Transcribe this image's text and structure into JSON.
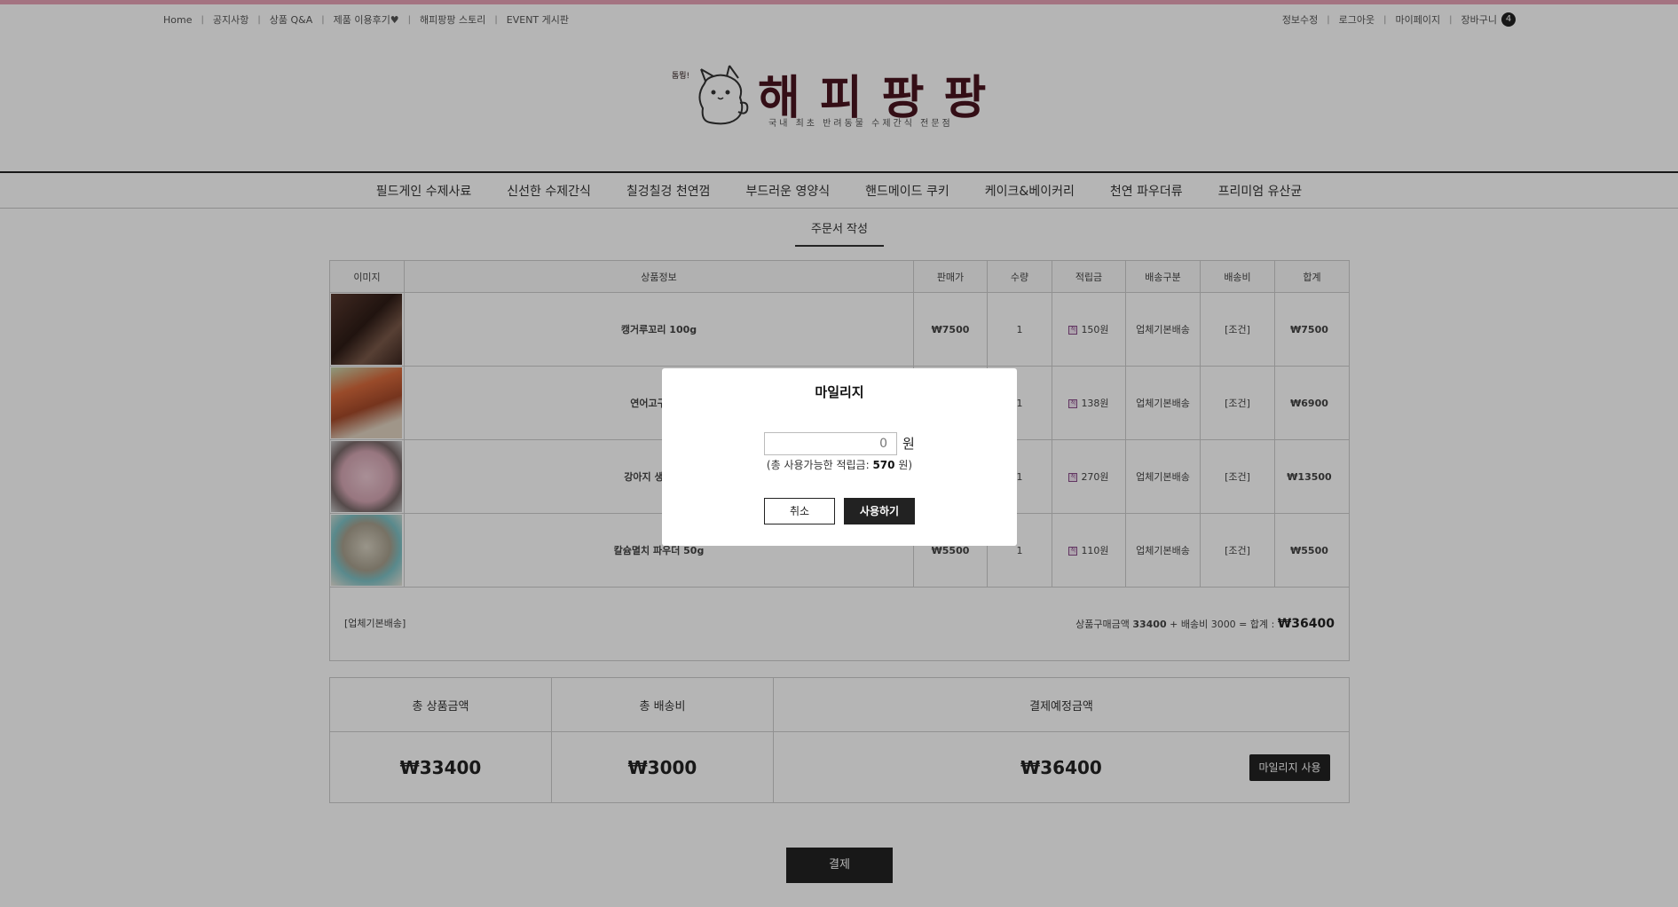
{
  "top_links": {
    "left": [
      "Home",
      "공지사항",
      "상품 Q&A",
      "제품 이용후기♥",
      "해피팡팡 스토리",
      "EVENT 게시판"
    ],
    "right": [
      "정보수정",
      "로그아웃",
      "마이페이지",
      "장바구니"
    ],
    "cart_count": "4"
  },
  "logo": {
    "small": "톰뭥!",
    "title": "해피팡팡",
    "subtitle": "국내 최초 반려동물 수제간식 전문점"
  },
  "nav": [
    "필드게인 수제사료",
    "신선한 수제간식",
    "칠겅칠겅 천연껌",
    "부드러운 영양식",
    "핸드메이드 쿠키",
    "케이크&베이커리",
    "천연 파우더류",
    "프리미엄 유산균"
  ],
  "page_heading": "주문서 작성",
  "table_headers": [
    "이미지",
    "상품정보",
    "판매가",
    "수량",
    "적립금",
    "배송구분",
    "배송비",
    "합계"
  ],
  "items": [
    {
      "name": "캥거루꼬리 100g",
      "price": "₩7500",
      "qty": "1",
      "points": "150원",
      "ship_type": "업체기본배송",
      "ship_fee": "[조건]",
      "total": "₩7500"
    },
    {
      "name": "연어고구마 아",
      "price": "",
      "qty": "1",
      "points": "138원",
      "ship_type": "업체기본배송",
      "ship_fee": "[조건]",
      "total": "₩6900"
    },
    {
      "name": "강아지 생일 보톨",
      "price": "",
      "qty": "1",
      "points": "270원",
      "ship_type": "업체기본배송",
      "ship_fee": "[조건]",
      "total": "₩13500"
    },
    {
      "name": "칼슘멸치 파우더 50g",
      "price": "₩5500",
      "qty": "1",
      "points": "110원",
      "ship_type": "업체기본배송",
      "ship_fee": "[조건]",
      "total": "₩5500"
    }
  ],
  "points_icon": "적",
  "summary": {
    "left": "[업체기본배송]",
    "pre": "상품구매금액 ",
    "goods": "33400",
    "mid": " + 배송비 3000 = 합계 : ",
    "grand": "₩36400"
  },
  "totals": {
    "headers": [
      "총 상품금액",
      "총 배송비",
      "결제예정금액"
    ],
    "goods_total": "₩33400",
    "shipping_total": "₩3000",
    "payment_total": "₩36400",
    "mileage_button": "마일리지 사용"
  },
  "pay_button": "결제",
  "modal": {
    "title": "마일리지",
    "input_value": "0",
    "won": "원",
    "note_prefix": "(총 사용가능한 적립금: ",
    "available": "570",
    "note_suffix": " 원)",
    "cancel": "취소",
    "use": "사용하기"
  },
  "colors": {
    "accent_strip": "#e8a3b6",
    "dark_button": "#222222",
    "overlay": "rgba(0,0,0,0.29)",
    "logo_text": "#4a1420"
  }
}
